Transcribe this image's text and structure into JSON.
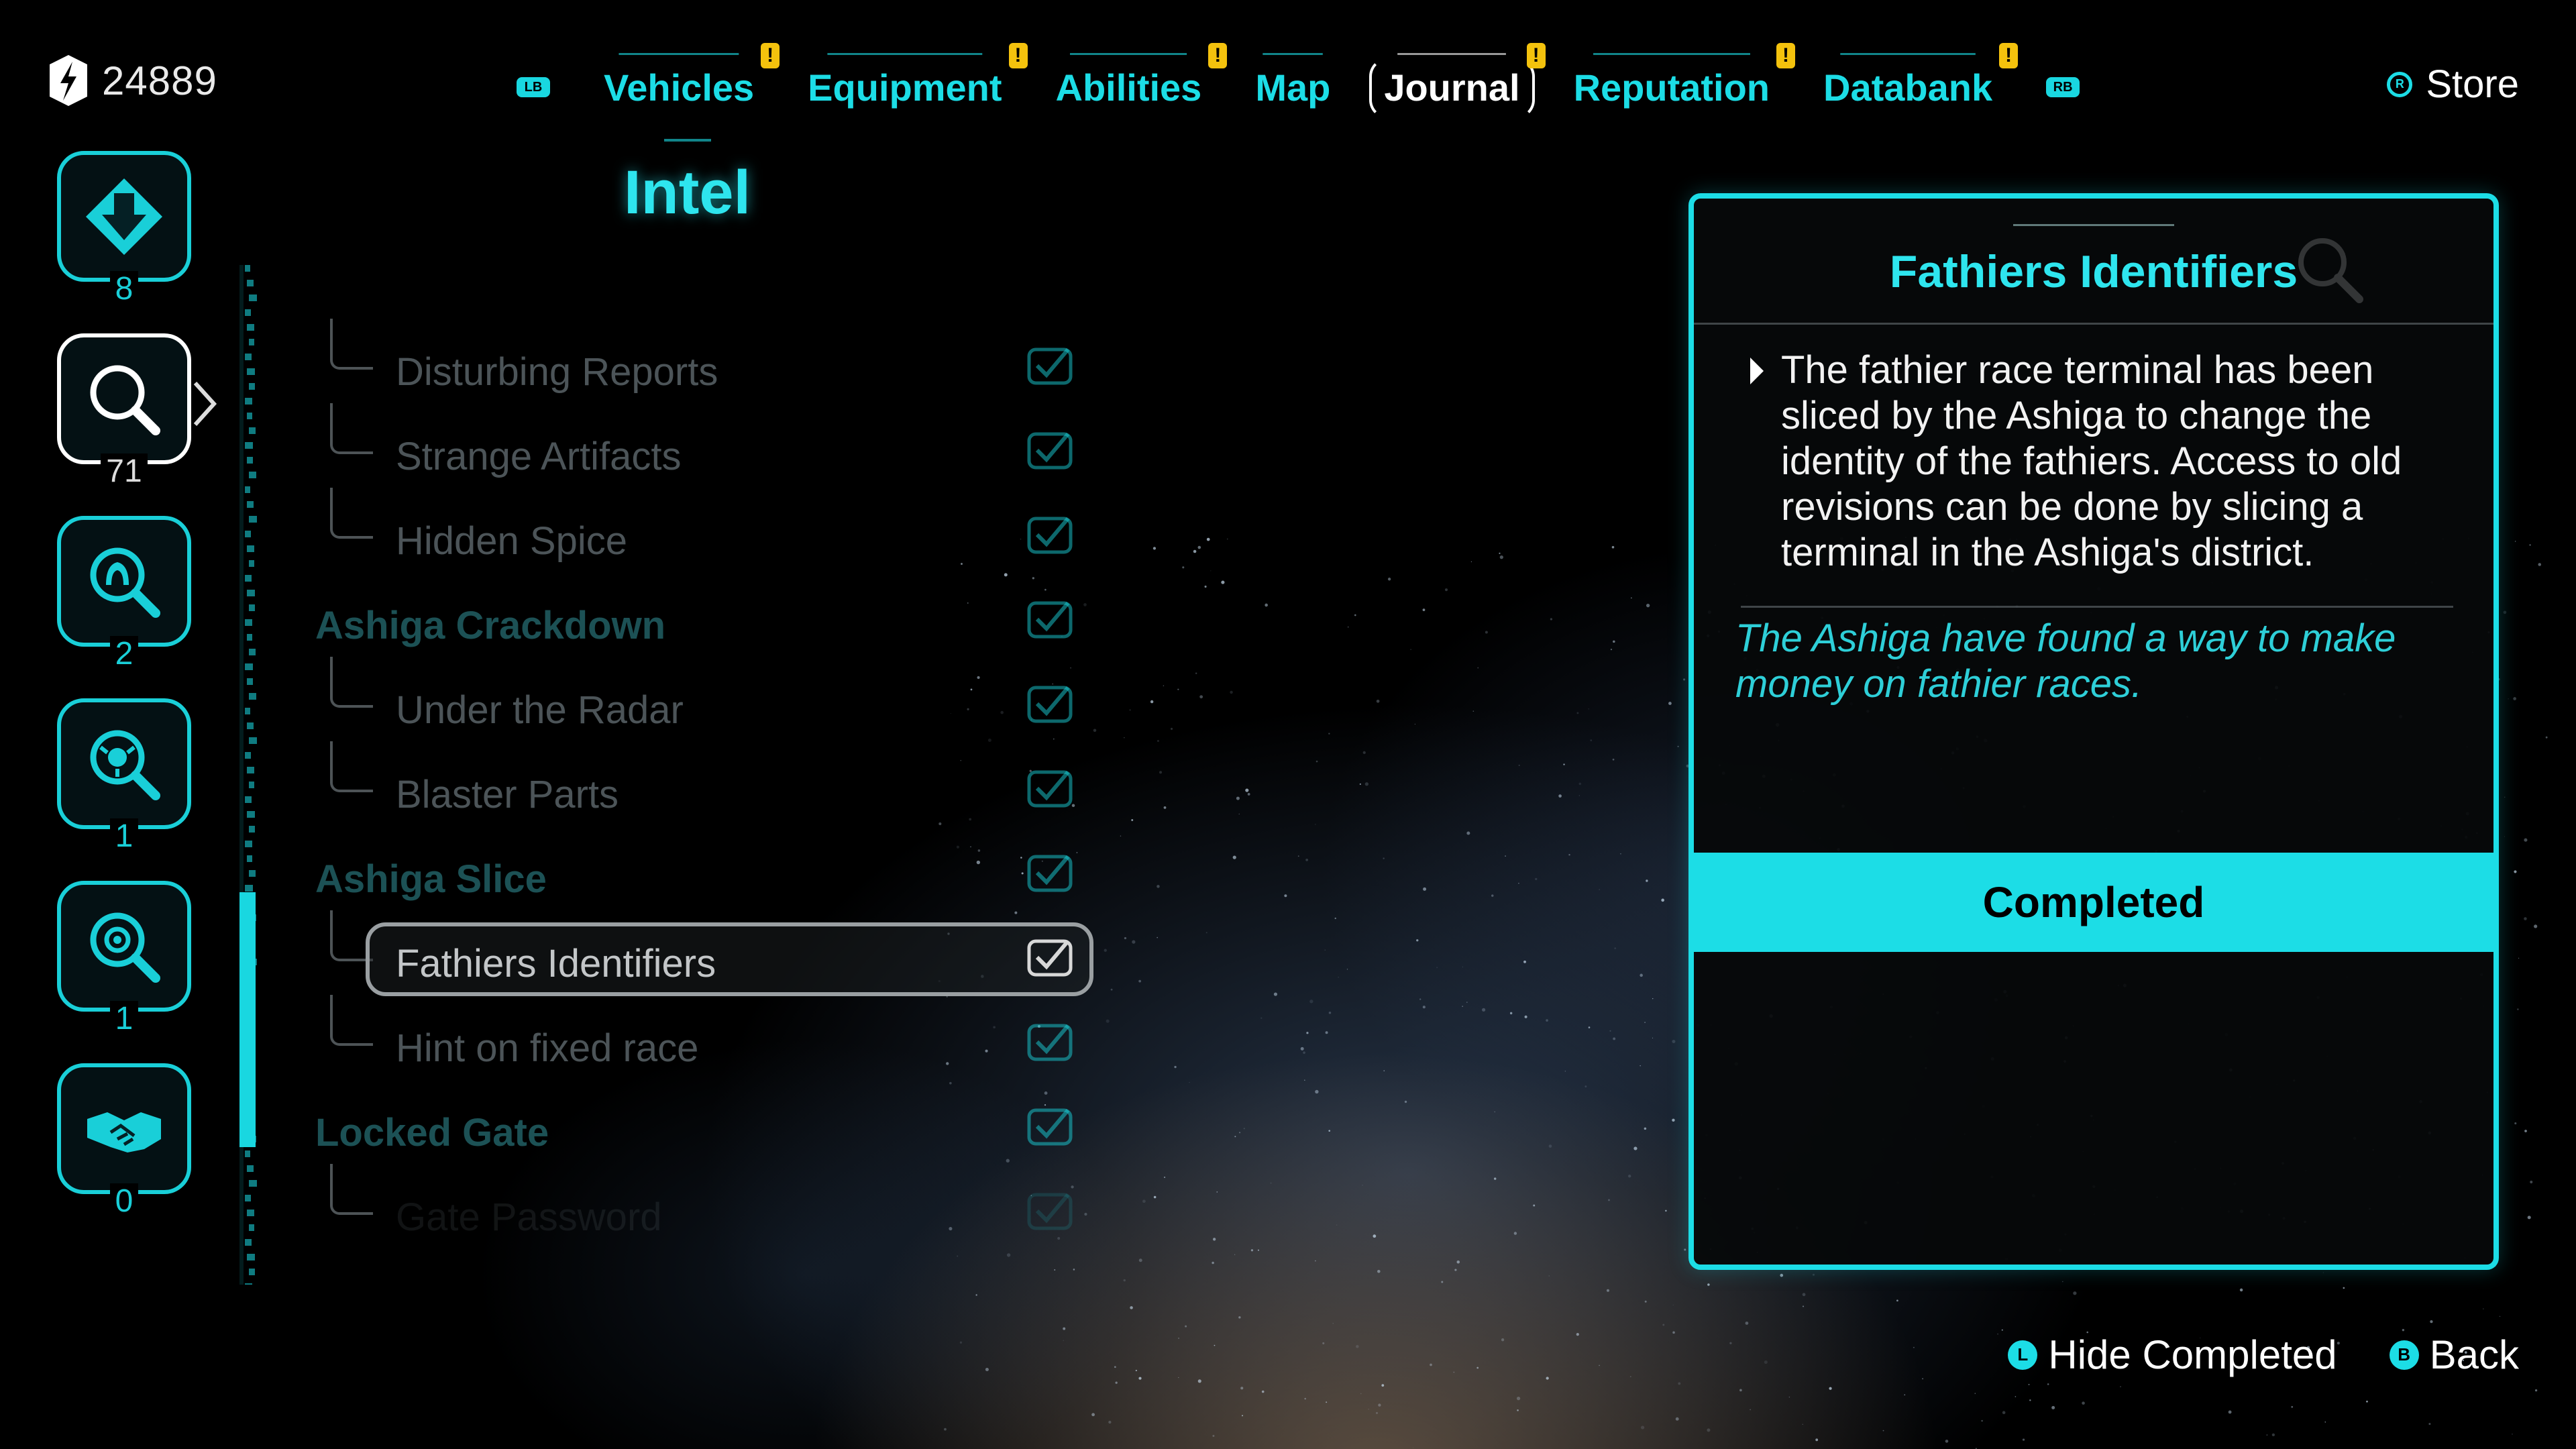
{
  "currency": {
    "amount": "24889",
    "icon": "credits-icon"
  },
  "nav": {
    "left_button": "LB",
    "right_button": "RB",
    "tabs": [
      {
        "label": "Vehicles",
        "alert": "!",
        "active": false
      },
      {
        "label": "Equipment",
        "alert": "!",
        "active": false
      },
      {
        "label": "Abilities",
        "alert": "!",
        "active": false
      },
      {
        "label": "Map",
        "alert": "",
        "active": false
      },
      {
        "label": "Journal",
        "alert": "!",
        "active": true
      },
      {
        "label": "Reputation",
        "alert": "!",
        "active": false
      },
      {
        "label": "Databank",
        "alert": "!",
        "active": false
      }
    ],
    "store_label": "Store",
    "store_button": "R"
  },
  "categories": [
    {
      "icon": "main-quest-icon",
      "count": "8"
    },
    {
      "icon": "intel-search-icon",
      "count": "71"
    },
    {
      "icon": "contact-search-icon",
      "count": "2"
    },
    {
      "icon": "faction-search-icon",
      "count": "1"
    },
    {
      "icon": "gear-search-icon",
      "count": "1"
    },
    {
      "icon": "handshake-icon",
      "count": "0"
    }
  ],
  "list": {
    "heading": "Intel",
    "items": [
      {
        "label": "Disturbing Reports",
        "level": "child",
        "completed": true
      },
      {
        "label": "Strange Artifacts",
        "level": "child",
        "completed": true
      },
      {
        "label": "Hidden Spice",
        "level": "child",
        "completed": true
      },
      {
        "label": "Ashiga Crackdown",
        "level": "parent",
        "completed": true
      },
      {
        "label": "Under the Radar",
        "level": "child",
        "completed": true
      },
      {
        "label": "Blaster Parts",
        "level": "child",
        "completed": true
      },
      {
        "label": "Ashiga Slice",
        "level": "parent",
        "completed": true
      },
      {
        "label": "Fathiers Identifiers",
        "level": "child",
        "completed": true,
        "selected": true
      },
      {
        "label": "Hint on fixed race",
        "level": "child",
        "completed": true
      },
      {
        "label": "Locked Gate",
        "level": "parent",
        "completed": true
      },
      {
        "label": "Gate Password",
        "level": "child",
        "completed": true,
        "faded": true
      }
    ]
  },
  "detail": {
    "title": "Fathiers Identifiers",
    "description": "The fathier race terminal has been sliced by the Ashiga to change the identity of the fathiers. Access to old revisions can be done by slicing a terminal in the Ashiga's district.",
    "flavor": "The Ashiga have found a way to make money on fathier races.",
    "status": "Completed"
  },
  "hints": {
    "hide_button": "L",
    "hide_label": "Hide Completed",
    "back_button": "B",
    "back_label": "Back"
  },
  "colors": {
    "accent": "#1cdde6",
    "alert": "#f4c20d",
    "background": "#000000"
  }
}
